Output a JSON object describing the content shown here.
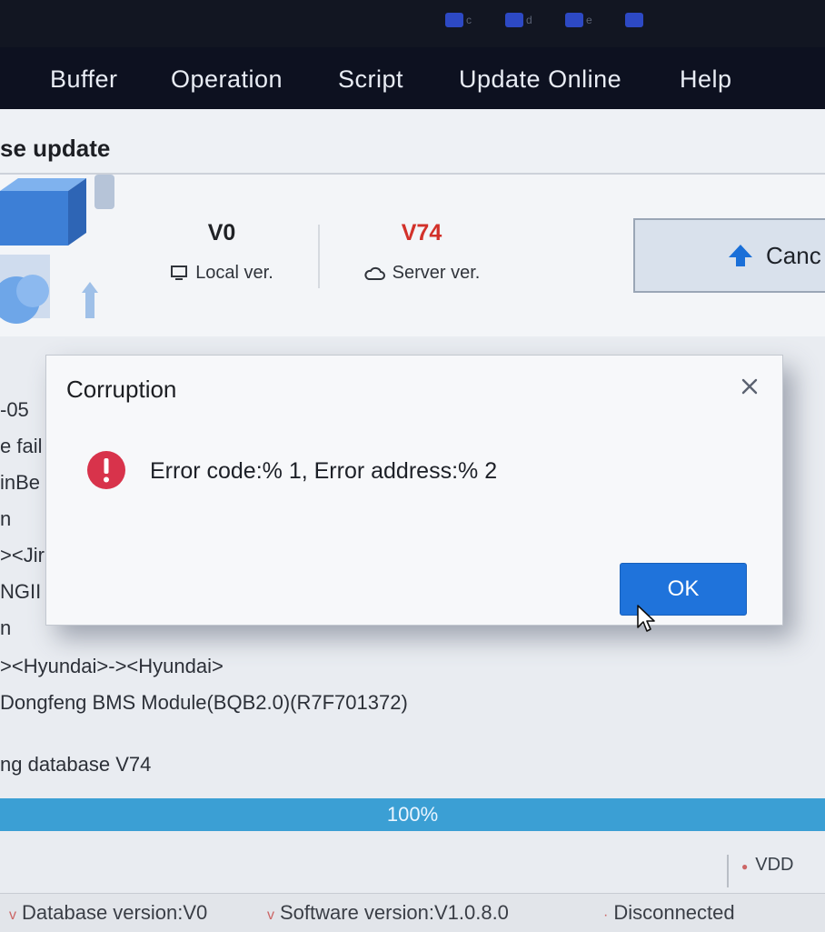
{
  "tray": [
    {
      "icon": "network-icon",
      "label": "c"
    },
    {
      "icon": "user-icon",
      "label": "d"
    },
    {
      "icon": "edit-icon",
      "label": "e"
    },
    {
      "icon": "upload-icon",
      "label": ""
    }
  ],
  "menu": {
    "items": [
      "Buffer",
      "Operation",
      "Script",
      "Update Online",
      "Help"
    ]
  },
  "window": {
    "title": "se update"
  },
  "versions": {
    "local_value": "V0",
    "local_label": "Local ver.",
    "server_value": "V74",
    "server_label": "Server ver.",
    "server_color": "#d2312a"
  },
  "cancel_button": {
    "label": "Canc"
  },
  "log_lines": [
    "-05",
    "e fail",
    "inBe",
    "n",
    "><Jir",
    "NGII",
    "n",
    "><Hyundai>-><Hyundai>",
    "Dongfeng BMS Module(BQB2.0)(R7F701372)",
    "ng database V74"
  ],
  "progress": {
    "value": 100,
    "text": "100%",
    "color": "#3b9fd4"
  },
  "vdd_label": "VDD",
  "status": {
    "database": "Database version:V0",
    "software": "Software version:V1.0.8.0",
    "connection": "Disconnected"
  },
  "dialog": {
    "title": "Corruption",
    "message": "Error code:% 1, Error address:% 2",
    "ok_label": "OK",
    "icon": "error-icon",
    "error_color": "#d8334b",
    "ok_color": "#1f73db"
  }
}
